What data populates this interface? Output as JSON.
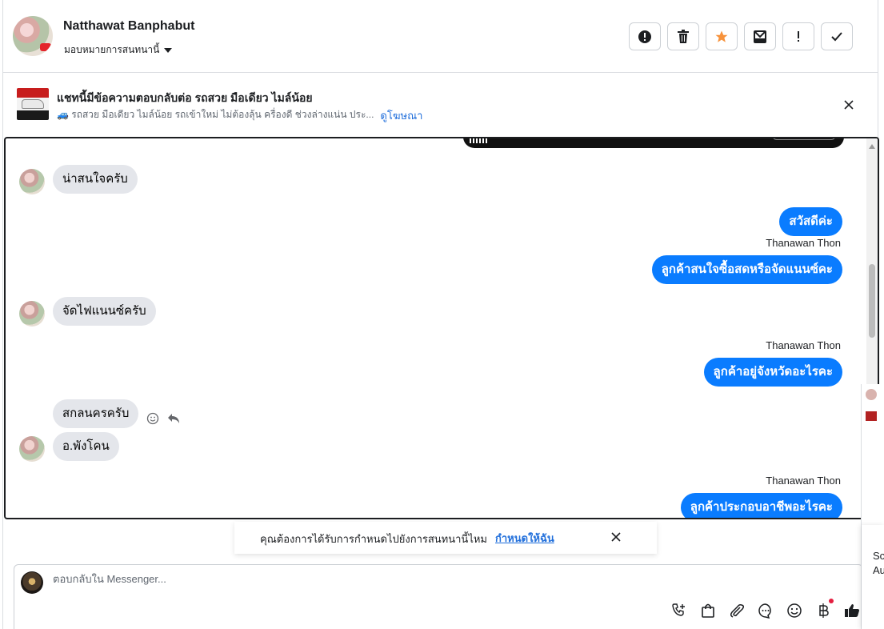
{
  "header": {
    "contact_name": "Natthawat Banphabut",
    "assign_label": "มอบหมายการสนทนานี้",
    "actions": [
      {
        "name": "report-icon"
      },
      {
        "name": "trash-icon"
      },
      {
        "name": "star-icon",
        "color": "#f7923b"
      },
      {
        "name": "mark-unread-icon"
      },
      {
        "name": "follow-up-icon"
      },
      {
        "name": "check-icon"
      }
    ]
  },
  "ad": {
    "title": "แชทนี้มีข้อความตอบกลับต่อ รถสวย มือเดียว ไมล์น้อย",
    "subtitle": "🚙 รถสวย มือเดียว ไมล์น้อย รถเข้าใหม่ ไม่ต้องลุ้น ครื่องดี ช่วงล่างแน่น ประ...",
    "link": "ดูโฆษณา"
  },
  "messages": [
    {
      "dir": "in",
      "text": "น่าสนใจครับ",
      "avatar": true
    },
    {
      "dir": "out",
      "text": "สวัสดีค่ะ"
    },
    {
      "dir": "out",
      "sender": "Thanawan Thon",
      "text": "ลูกค้าสนใจซื้อสดหรือจัดแนนซ์คะ"
    },
    {
      "dir": "in",
      "text": "จัดไฟแนนซ์ครับ",
      "avatar": true
    },
    {
      "dir": "out",
      "sender": "Thanawan Thon",
      "text": "ลูกค้าอยู่จังหวัดอะไรคะ"
    },
    {
      "dir": "in",
      "text": "สกลนครครับ"
    },
    {
      "dir": "in",
      "text": "อ.พังโคน",
      "avatar": true
    },
    {
      "dir": "out",
      "sender": "Thanawan Thon",
      "text": "ลูกค้าประกอบอาชีพอะไรคะ"
    }
  ],
  "suggestion": {
    "text": "คุณต้องการได้รับการกำหนดไปยังการสนทนานี้ไหม",
    "link": "กำหนดให้ฉัน"
  },
  "composer": {
    "placeholder": "ตอบกลับใน Messenger...",
    "tools": [
      "call-icon",
      "shopping-bag-icon",
      "attach-icon",
      "saved-reply-icon",
      "emoji-icon",
      "baht-icon",
      "like-icon"
    ]
  },
  "edge": {
    "text_line1": "Sc",
    "text_line2": "Au"
  },
  "colors": {
    "outgoing_bubble": "#0a7cff",
    "incoming_bubble": "#e4e6eb",
    "link": "#216fdb"
  }
}
